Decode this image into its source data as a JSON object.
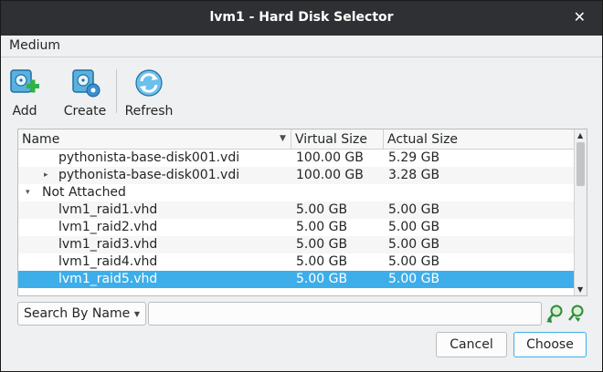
{
  "window": {
    "title": "lvm1 - Hard Disk Selector",
    "close_glyph": "✕"
  },
  "menubar": {
    "items": [
      "Medium"
    ]
  },
  "toolbar": {
    "add_label": "Add",
    "create_label": "Create",
    "refresh_label": "Refresh",
    "icons": {
      "add": "disk-add-icon",
      "create": "disk-create-icon",
      "refresh": "refresh-icon"
    }
  },
  "list": {
    "columns": [
      "Name",
      "Virtual Size",
      "Actual Size"
    ],
    "rows": [
      {
        "name": "pythonista-base-disk001.vdi",
        "virtual": "100.00 GB",
        "actual": "5.29 GB",
        "expander": "",
        "selected": false
      },
      {
        "name": "pythonista-base-disk001.vdi",
        "virtual": "100.00 GB",
        "actual": "3.28 GB",
        "expander": "▸",
        "selected": false
      },
      {
        "name": "Not Attached",
        "virtual": "",
        "actual": "",
        "expander": "▾",
        "selected": false
      },
      {
        "name": "lvm1_raid1.vhd",
        "virtual": "5.00 GB",
        "actual": "5.00 GB",
        "expander": "",
        "selected": false
      },
      {
        "name": "lvm1_raid2.vhd",
        "virtual": "5.00 GB",
        "actual": "5.00 GB",
        "expander": "",
        "selected": false
      },
      {
        "name": "lvm1_raid3.vhd",
        "virtual": "5.00 GB",
        "actual": "5.00 GB",
        "expander": "",
        "selected": false
      },
      {
        "name": "lvm1_raid4.vhd",
        "virtual": "5.00 GB",
        "actual": "5.00 GB",
        "expander": "",
        "selected": false
      },
      {
        "name": "lvm1_raid5.vhd",
        "virtual": "5.00 GB",
        "actual": "5.00 GB",
        "expander": "",
        "selected": true
      }
    ]
  },
  "search": {
    "mode": "Search By Name",
    "value": ""
  },
  "buttons": {
    "cancel": "Cancel",
    "choose": "Choose"
  },
  "colors": {
    "titlebar": "#2f3033",
    "selection": "#3daee9",
    "window_bg": "#eff0f1"
  }
}
